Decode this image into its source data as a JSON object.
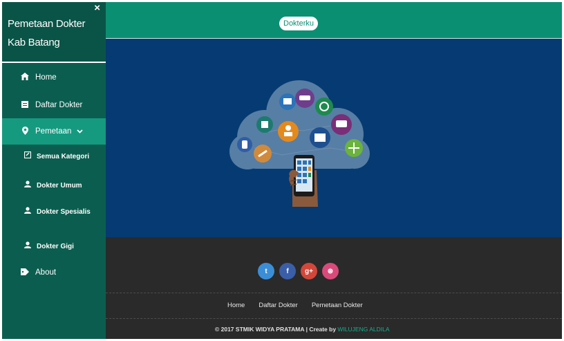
{
  "sidebar": {
    "brand": "Pemetaan Dokter Kab Batang",
    "close": "×",
    "items": [
      {
        "label": "Home",
        "icon": "home-icon"
      },
      {
        "label": "Daftar Dokter",
        "icon": "list-icon"
      },
      {
        "label": "Pemetaan",
        "icon": "map-pin-icon",
        "chevron": "⌄"
      },
      {
        "label": "About",
        "icon": "tag-icon"
      }
    ],
    "subitems": [
      {
        "label": "Semua Kategori",
        "icon": "edit-icon"
      },
      {
        "label": "Dokter Umum",
        "icon": "user-icon"
      },
      {
        "label": "Dokter Spesialis",
        "icon": "user-icon"
      },
      {
        "label": "Dokter Gigi",
        "icon": "user-icon"
      }
    ]
  },
  "header": {
    "logo": "Dokterku"
  },
  "footer": {
    "social": [
      {
        "name": "twitter-icon",
        "glyph": "t",
        "color": "#3b8ed6"
      },
      {
        "name": "facebook-icon",
        "glyph": "f",
        "color": "#3b5ea8"
      },
      {
        "name": "googleplus-icon",
        "glyph": "g+",
        "color": "#d2473a"
      },
      {
        "name": "dribbble-icon",
        "glyph": "⊛",
        "color": "#d94a7a"
      }
    ],
    "nav": [
      "Home",
      "Daftar Dokter",
      "Pemetaan Dokter"
    ],
    "copyright": "© 2017 STMIK WIDYA PRATAMA | Create by ",
    "author": "WILUJENG ALDILA"
  },
  "colors": {
    "sidebar": "#0b5e4f",
    "accent": "#0b8f73",
    "active": "#159a80",
    "hero": "#063a72",
    "footer": "#2a2a2a"
  }
}
